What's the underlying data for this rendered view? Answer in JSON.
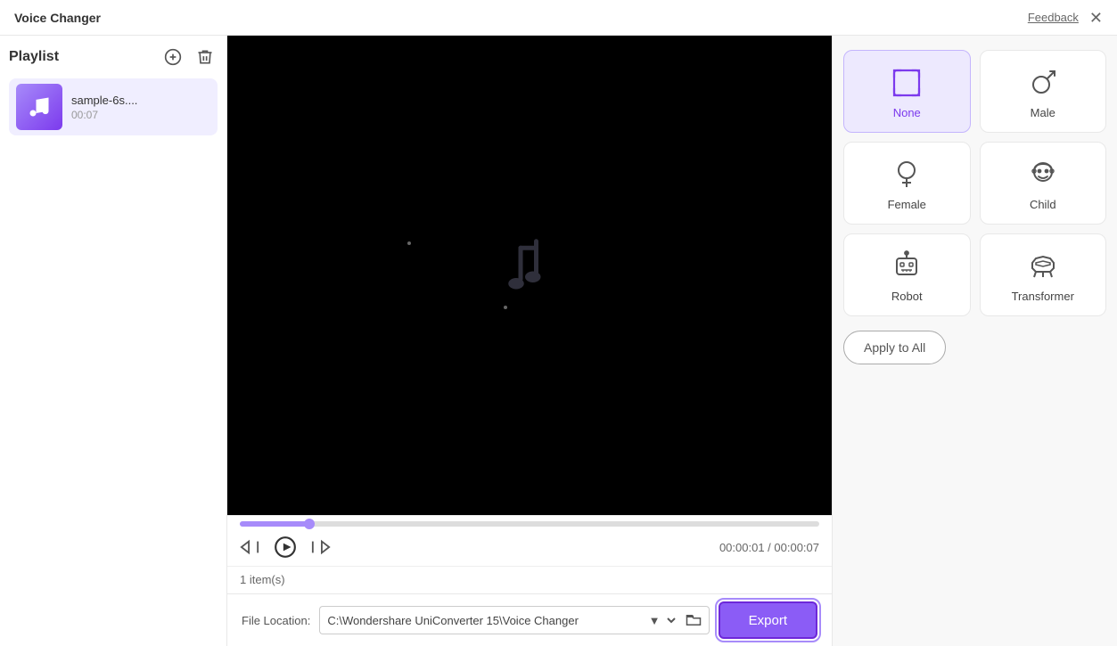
{
  "titleBar": {
    "title": "Voice Changer",
    "feedbackLabel": "Feedback",
    "closeLabel": "✕"
  },
  "sidebar": {
    "playlistTitle": "Playlist",
    "addIcon": "⊕",
    "deleteIcon": "🗑",
    "items": [
      {
        "name": "sample-6s....",
        "duration": "00:07"
      }
    ]
  },
  "player": {
    "progressPercent": 12,
    "currentTime": "00:00:01",
    "totalTime": "00:00:07",
    "timeDisplay": "00:00:01 / 00:00:07",
    "itemsCount": "1 item(s)"
  },
  "fileLocation": {
    "label": "File Location:",
    "path": "C:\\Wondershare UniConverter 15\\Voice Changer",
    "placeholder": "C:\\Wondershare UniConverter 15\\Voice Changer"
  },
  "exportBtn": {
    "label": "Export"
  },
  "effectsPanel": {
    "effects": [
      {
        "id": "none",
        "label": "None",
        "active": true
      },
      {
        "id": "male",
        "label": "Male",
        "active": false
      },
      {
        "id": "female",
        "label": "Female",
        "active": false
      },
      {
        "id": "child",
        "label": "Child",
        "active": false
      },
      {
        "id": "robot",
        "label": "Robot",
        "active": false
      },
      {
        "id": "transformer",
        "label": "Transformer",
        "active": false
      }
    ],
    "applyAllLabel": "Apply to All"
  }
}
